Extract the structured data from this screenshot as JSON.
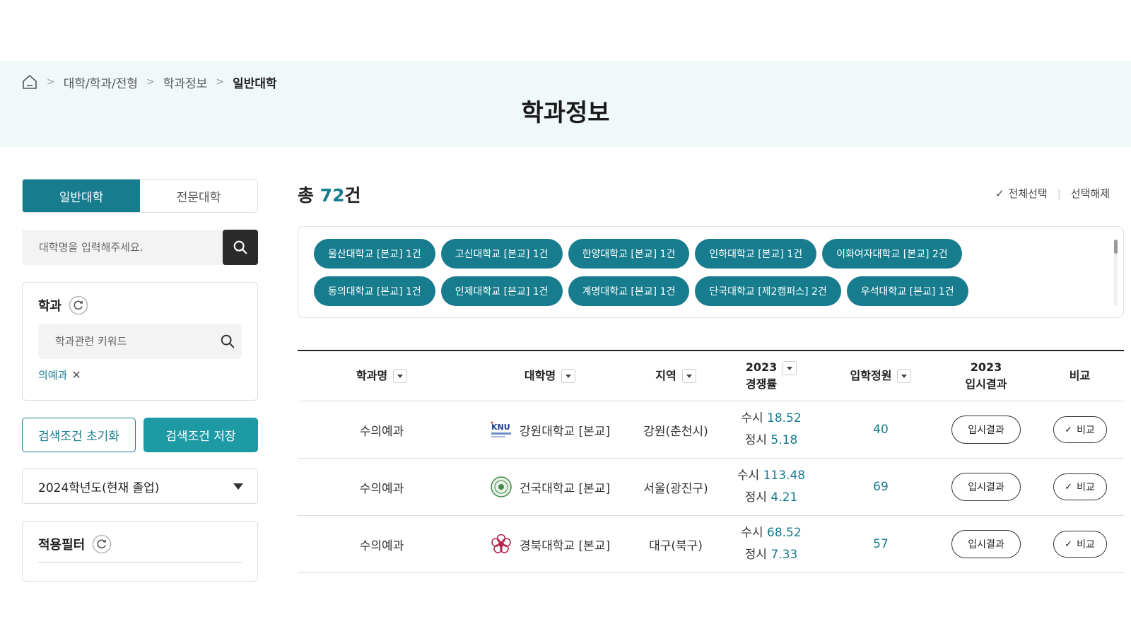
{
  "breadcrumb": {
    "items": [
      "대학/학과/전형",
      "학과정보",
      "일반대학"
    ],
    "separator": ">"
  },
  "page_title": "학과정보",
  "sidebar": {
    "tabs": [
      {
        "label": "일반대학",
        "active": true
      },
      {
        "label": "전문대학",
        "active": false
      }
    ],
    "univ_search": {
      "placeholder": "대학명을 입력해주세요.",
      "value": ""
    },
    "dept": {
      "title": "학과",
      "search_placeholder": "학과관련 키워드",
      "selected_tag": "의예과",
      "tag_remove": "✕"
    },
    "reset_button": "검색조건 초기화",
    "save_button": "검색조건 저장",
    "year_select": {
      "value": "2024학년도(현재 졸업)"
    },
    "applied_filter": {
      "title": "적용필터"
    }
  },
  "main": {
    "total_prefix": "총",
    "total_count": "72",
    "total_suffix": "건",
    "select_all": "전체선택",
    "deselect": "선택해제",
    "select_check": "✓",
    "chips": [
      "울산대학교 [본교] 1건",
      "고신대학교 [본교] 1건",
      "한양대학교 [본교] 1건",
      "인하대학교 [본교] 1건",
      "이화여자대학교 [본교] 2건",
      "동의대학교 [본교] 1건",
      "인제대학교 [본교] 1건",
      "계명대학교 [본교] 1건",
      "단국대학교 [제2캠퍼스] 2건",
      "우석대학교 [본교] 1건"
    ],
    "table": {
      "headers": {
        "dept": "학과명",
        "univ": "대학명",
        "region": "지역",
        "rate_line1": "2023",
        "rate_line2": "경쟁률",
        "quota": "입학정원",
        "result_line1": "2023",
        "result_line2": "입시결과",
        "compare": "비교"
      },
      "rate_labels": {
        "susi": "수시",
        "jeongsi": "정시"
      },
      "result_button": "입시결과",
      "compare_button": "비교",
      "compare_check": "✓",
      "rows": [
        {
          "dept": "수의예과",
          "univ": "강원대학교 [본교]",
          "logo": "knu-logo",
          "region": "강원(춘천시)",
          "susi": "18.52",
          "jeongsi": "5.18",
          "quota": "40"
        },
        {
          "dept": "수의예과",
          "univ": "건국대학교 [본교]",
          "logo": "konkuk-logo",
          "region": "서울(광진구)",
          "susi": "113.48",
          "jeongsi": "4.21",
          "quota": "69"
        },
        {
          "dept": "수의예과",
          "univ": "경북대학교 [본교]",
          "logo": "knu-kyungpook-logo",
          "region": "대구(북구)",
          "susi": "68.52",
          "jeongsi": "7.33",
          "quota": "57"
        }
      ]
    }
  },
  "colors": {
    "accent": "#167c8e",
    "save_button": "#1e9aa5",
    "hero_bg": "#f1f8f9"
  }
}
